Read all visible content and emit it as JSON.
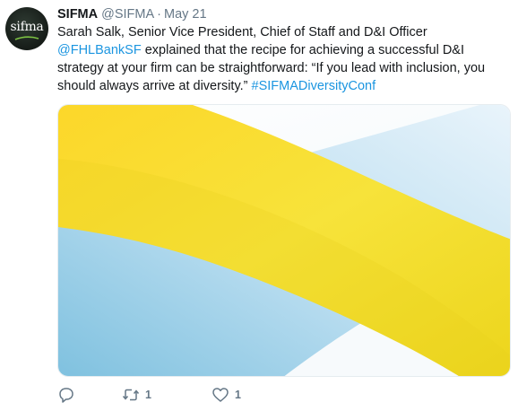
{
  "tweet": {
    "avatar_text": "sifma",
    "author_name": "SIFMA",
    "handle": "@SIFMA",
    "separator": "·",
    "date": "May 21",
    "text_part1": "Sarah Salk, Senior Vice President, Chief of Staff and D&I Officer ",
    "mention": "@FHLBankSF",
    "text_part2": " explained that the recipe for achieving a successful D&I strategy at your firm can be straightforward: “If you lead with inclusion, you should always arrive at diversity.” ",
    "hashtag": "#SIFMADiversityConf",
    "media_description": "yellow-and-blue-ribbon-graphic"
  },
  "actions": {
    "reply_icon": "reply-icon",
    "retweet_icon": "retweet-icon",
    "retweet_count": "1",
    "like_icon": "heart-icon",
    "like_count": "1"
  },
  "colors": {
    "link": "#1b95e0",
    "muted": "#657786",
    "text": "#14171a",
    "ribbon_yellow": "#f5dc1e",
    "background_blue": "#a9d3ea"
  }
}
